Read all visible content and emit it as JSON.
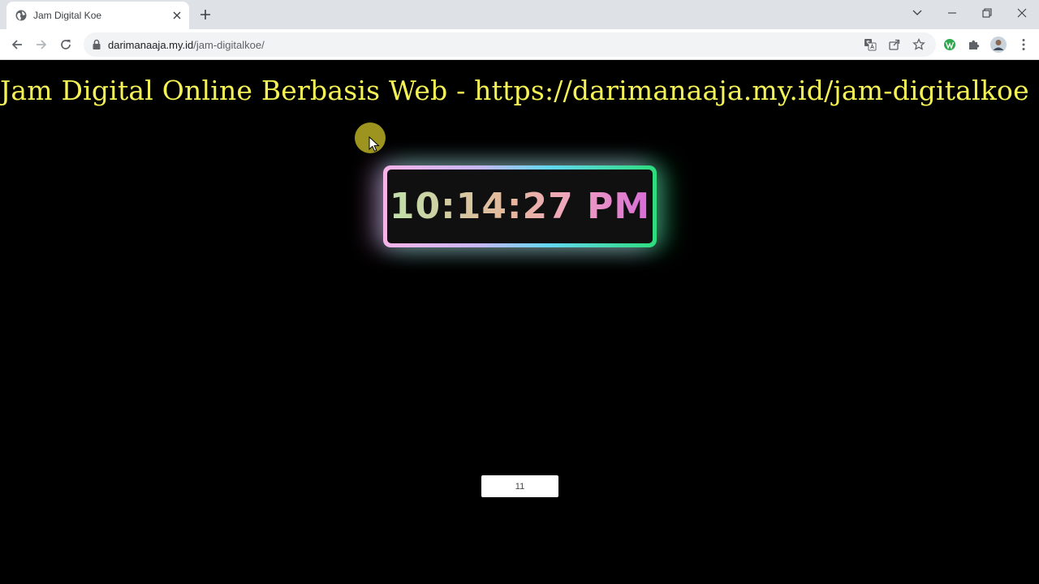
{
  "browser": {
    "tab": {
      "title": "Jam Digital Koe"
    },
    "address_bar": {
      "domain": "darimanaaja.my.id",
      "path": "/jam-digitalkoe/"
    }
  },
  "icons": {
    "tab_favicon": "globe-icon",
    "tab_close": "close-icon",
    "new_tab": "plus-icon",
    "tab_search": "chevron-down-icon",
    "minimize": "minimize-icon",
    "restore": "restore-icon",
    "close_window": "close-icon",
    "back": "arrow-left-icon",
    "forward": "arrow-right-icon",
    "reload": "reload-icon",
    "lock": "lock-icon",
    "translate": "translate-icon",
    "share": "share-icon",
    "bookmark": "star-icon",
    "wordpress": "wordpress-icon",
    "extensions": "puzzle-icon",
    "profile": "avatar-icon",
    "menu": "kebab-menu-icon"
  },
  "page": {
    "headline": "Jam Digital Online Berbasis Web - https://darimanaaja.my.id/jam-digitalkoe",
    "clock": {
      "time": "10:14:27 PM"
    },
    "counter": {
      "value": "11"
    }
  },
  "colors": {
    "headline": "#f4f255",
    "page_background": "#000000",
    "frame_gradient_start": "#f7b3e8",
    "frame_gradient_end": "#2ddc7c",
    "clock_text_start": "#bfe0a9",
    "clock_text_end": "#d86bd8"
  }
}
